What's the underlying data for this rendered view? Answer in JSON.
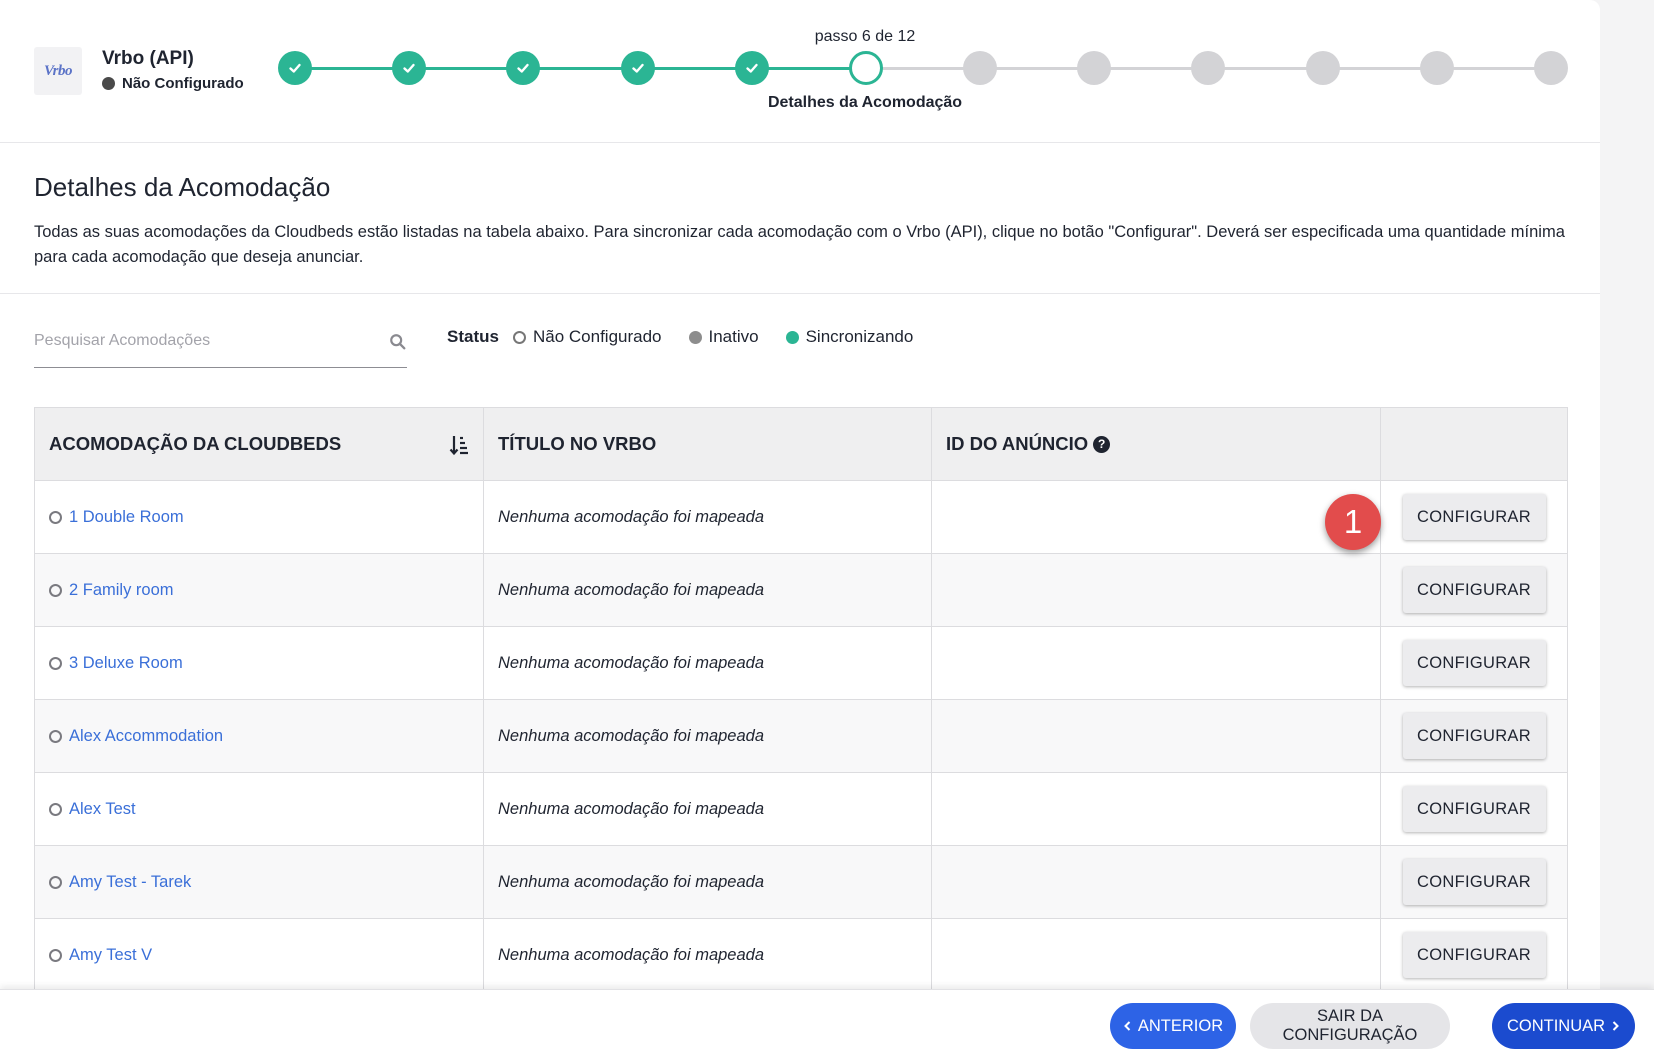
{
  "header": {
    "logo_text": "Vrbo",
    "app_title": "Vrbo (API)",
    "app_status": "Não Configurado",
    "step_counter": "passo 6 de 12",
    "current_step_label": "Detalhes da Acomodação",
    "steps_total": 12,
    "steps_completed": 5,
    "current_step": 6,
    "colors": {
      "done": "#2bb594",
      "todo": "#d3d3d6"
    }
  },
  "section": {
    "title": "Detalhes da Acomodação",
    "description": "Todas as suas acomodações da Cloudbeds estão listadas na tabela abaixo. Para sincronizar cada acomodação com o Vrbo (API), clique no botão \"Configurar\". Deverá ser especificada uma quantidade mínima para cada acomodação que deseja anunciar."
  },
  "search": {
    "placeholder": "Pesquisar Acomodações",
    "value": "",
    "icon": "search-icon"
  },
  "legend": {
    "label": "Status",
    "items": [
      {
        "label": "Não Configurado",
        "color": "#ffffff"
      },
      {
        "label": "Inativo",
        "color": "#8d8d8d"
      },
      {
        "label": "Sincronizando",
        "color": "#2bb594"
      }
    ]
  },
  "table": {
    "headers": [
      "ACOMODAÇÃO DA CLOUDBEDS",
      "TÍTULO NO VRBO",
      "ID DO ANÚNCIO",
      ""
    ],
    "rows": [
      {
        "name": "1 Double Room",
        "vrbo_title": "Nenhuma acomodação foi mapeada",
        "listing_id": "",
        "action": "CONFIGURAR"
      },
      {
        "name": "2 Family room",
        "vrbo_title": "Nenhuma acomodação foi mapeada",
        "listing_id": "",
        "action": "CONFIGURAR"
      },
      {
        "name": "3 Deluxe Room",
        "vrbo_title": "Nenhuma acomodação foi mapeada",
        "listing_id": "",
        "action": "CONFIGURAR"
      },
      {
        "name": "Alex Accommodation",
        "vrbo_title": "Nenhuma acomodação foi mapeada",
        "listing_id": "",
        "action": "CONFIGURAR"
      },
      {
        "name": "Alex Test",
        "vrbo_title": "Nenhuma acomodação foi mapeada",
        "listing_id": "",
        "action": "CONFIGURAR"
      },
      {
        "name": "Amy Test - Tarek",
        "vrbo_title": "Nenhuma acomodação foi mapeada",
        "listing_id": "",
        "action": "CONFIGURAR"
      },
      {
        "name": "Amy Test V",
        "vrbo_title": "Nenhuma acomodação foi mapeada",
        "listing_id": "",
        "action": "CONFIGURAR"
      }
    ]
  },
  "annotation": {
    "marker_label": "1",
    "color": "#e24c4c"
  },
  "footer": {
    "prev_label": "ANTERIOR",
    "exit_label": "SAIR DA CONFIGURAÇÃO",
    "next_label": "CONTINUAR"
  }
}
